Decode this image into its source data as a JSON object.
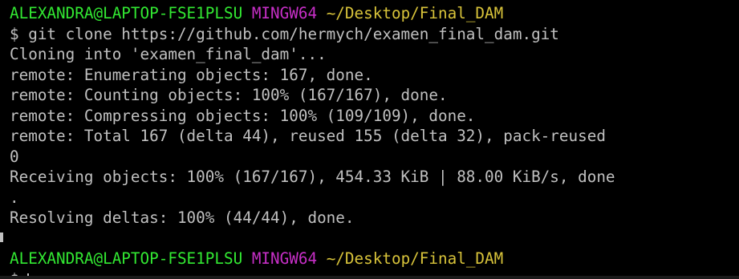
{
  "prompt1": {
    "user_host": "ALEXANDRA@LAPTOP-FSE1PLSU",
    "env": "MINGW64",
    "path": "~/Desktop/Final_DAM"
  },
  "output": {
    "command": "$ git clone https://github.com/hermych/examen_final_dam.git",
    "l1": "Cloning into 'examen_final_dam'...",
    "l2": "remote: Enumerating objects: 167, done.",
    "l3": "remote: Counting objects: 100% (167/167), done.",
    "l4": "remote: Compressing objects: 100% (109/109), done.",
    "l5": "remote: Total 167 (delta 44), reused 155 (delta 32), pack-reused",
    "l6": "0",
    "l7": "Receiving objects: 100% (167/167), 454.33 KiB | 88.00 KiB/s, done",
    "l8": ".",
    "l9": "Resolving deltas: 100% (44/44), done."
  },
  "prompt2": {
    "user_host": "ALEXANDRA@LAPTOP-FSE1PLSU",
    "env": "MINGW64",
    "path": "~/Desktop/Final_DAM",
    "input_prefix": "$"
  },
  "colors": {
    "background": "#000000",
    "text": "#c0c0c0",
    "user_host": "#32e832",
    "env": "#c72fc7",
    "path": "#d8c33a"
  }
}
